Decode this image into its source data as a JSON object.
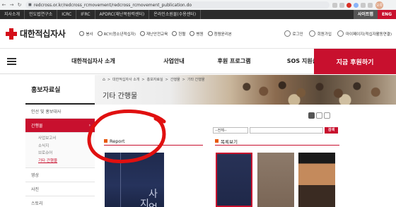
{
  "browser": {
    "url": "redcross.or.kr/redcross_rcmovement/redcross_rcmovement_publication.do",
    "profile_initial": "오류"
  },
  "topbar": {
    "links": [
      "지사소개",
      "인도법연구소",
      "ICRC",
      "IFRC",
      "APDRC(재난복원력센터)",
      "온라인소원물(수용센터)"
    ],
    "sitemap": "사이트맵",
    "lang": "ENG"
  },
  "header": {
    "logo_text": "대한적십자사",
    "services": [
      "봉사",
      "RCY(청소년적십자)",
      "재난안전교육",
      "헌혈",
      "병원",
      "청렴윤리본"
    ],
    "user_links": [
      "로그인",
      "회원가입",
      "마이페이지(적십자활동연결)"
    ]
  },
  "mainnav": {
    "items": [
      "대한적십자사 소개",
      "사업안내",
      "후원 프로그램",
      "SOS 지원신청"
    ],
    "donate": "지금 후원하기"
  },
  "sidebar": {
    "title": "홍보자료실",
    "items": [
      "인선 및 홍보대사",
      "간행물"
    ],
    "sub_items": [
      "사업보고서",
      "소식지",
      "브로슈어",
      "기타 간행물"
    ],
    "more_items": [
      "영상",
      "사진",
      "스토리"
    ]
  },
  "breadcrumb": [
    "대한적십자사 소개",
    "홍보자료실",
    "간행물",
    "기타 간행물"
  ],
  "page_title": "기타 간행물",
  "search": {
    "select_value": "--전체--",
    "button_label": "검색"
  },
  "sections": {
    "left_heading": "Report",
    "right_heading": "목록보기"
  },
  "report": {
    "big_text_1": "사업",
    "big_text_2": "지"
  },
  "colors": {
    "accent": "#c8102e",
    "topbar": "#2b2b2b"
  }
}
